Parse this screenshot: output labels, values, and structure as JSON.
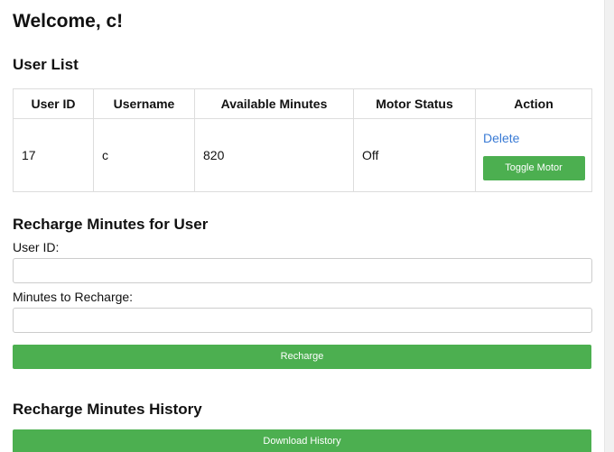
{
  "welcome": "Welcome, c!",
  "user_list": {
    "heading": "User List",
    "columns": [
      "User ID",
      "Username",
      "Available Minutes",
      "Motor Status",
      "Action"
    ],
    "rows": [
      {
        "user_id": "17",
        "username": "c",
        "available_minutes": "820",
        "motor_status": "Off",
        "delete_label": "Delete",
        "toggle_label": "Toggle Motor"
      }
    ]
  },
  "recharge": {
    "heading": "Recharge Minutes for User",
    "user_id_label": "User ID:",
    "user_id_value": "",
    "minutes_label": "Minutes to Recharge:",
    "minutes_value": "",
    "button_label": "Recharge"
  },
  "history": {
    "heading": "Recharge Minutes History",
    "download_label": "Download History"
  },
  "colors": {
    "button_green": "#4caf50",
    "link_blue": "#3a7bd5"
  }
}
